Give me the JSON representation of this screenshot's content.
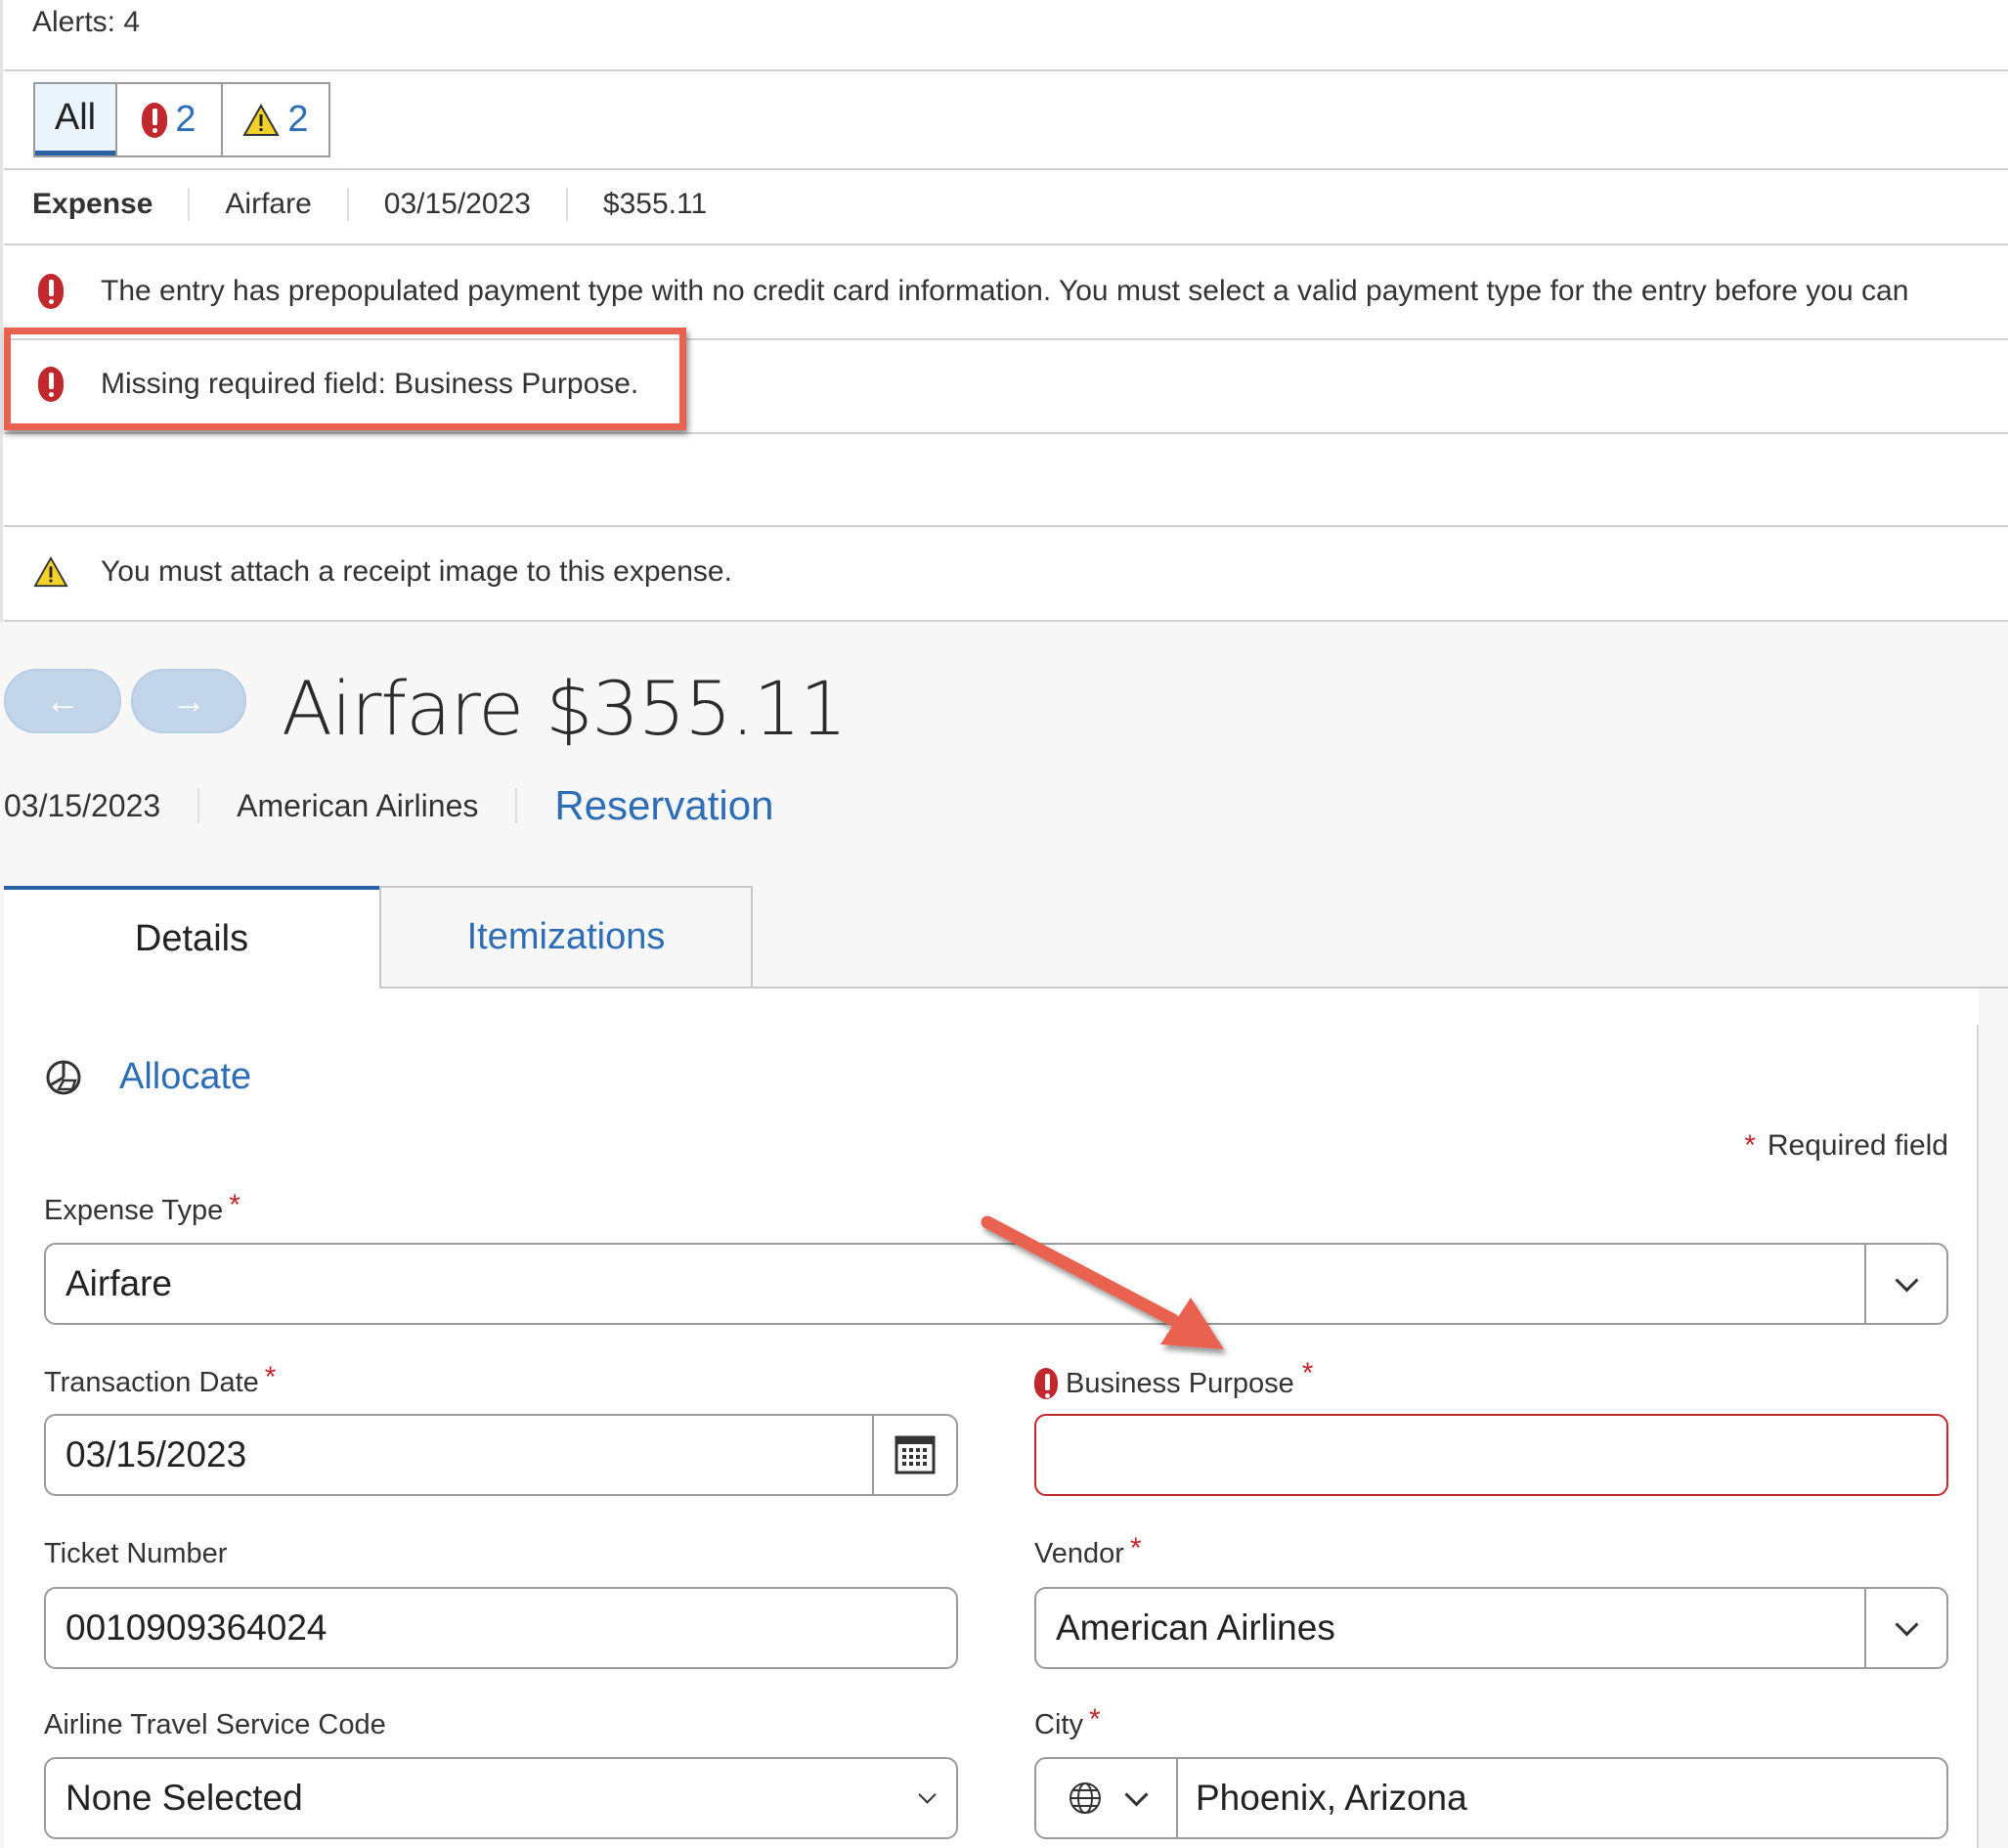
{
  "alerts": {
    "title": "Alerts: 4",
    "filters": {
      "all_label": "All",
      "error_count": "2",
      "warning_count": "2"
    },
    "summary": {
      "type_label": "Expense",
      "expense_type": "Airfare",
      "date": "03/15/2023",
      "amount": "$355.11"
    },
    "items": [
      {
        "severity": "error",
        "icon": "error-exclamation-icon",
        "text": "The entry has prepopulated payment type with no credit card information. You must select a valid payment type for the entry before you can"
      },
      {
        "severity": "error",
        "icon": "error-exclamation-icon",
        "text": "Missing required field: Business Purpose."
      },
      {
        "severity": "warning",
        "icon": "warning-triangle-icon",
        "text": "You must attach a receipt image to this expense."
      }
    ]
  },
  "header": {
    "prev_icon": "←",
    "next_icon": "→",
    "title": "Airfare $355.11",
    "date": "03/15/2023",
    "vendor": "American Airlines",
    "link": "Reservation"
  },
  "tabs": [
    {
      "label": "Details",
      "active": true
    },
    {
      "label": "Itemizations",
      "active": false
    }
  ],
  "form": {
    "allocate_label": "Allocate",
    "required_note": "Required field",
    "required_marker": "*",
    "fields": {
      "expense_type": {
        "label": "Expense Type",
        "value": "Airfare",
        "required": true
      },
      "transaction_date": {
        "label": "Transaction Date",
        "value": "03/15/2023",
        "required": true
      },
      "business_purpose": {
        "label": "Business Purpose",
        "value": "",
        "required": true,
        "error": true
      },
      "ticket_number": {
        "label": "Ticket Number",
        "value": "0010909364024",
        "required": false
      },
      "vendor": {
        "label": "Vendor",
        "value": "American Airlines",
        "required": true
      },
      "airline_service_code": {
        "label": "Airline Travel Service Code",
        "value": "None Selected",
        "required": false
      },
      "city": {
        "label": "City",
        "value": "Phoenix, Arizona",
        "required": true
      }
    }
  },
  "annotation_colors": {
    "highlight": "#e8624f",
    "error": "#c0282d",
    "link": "#2d6db6"
  }
}
